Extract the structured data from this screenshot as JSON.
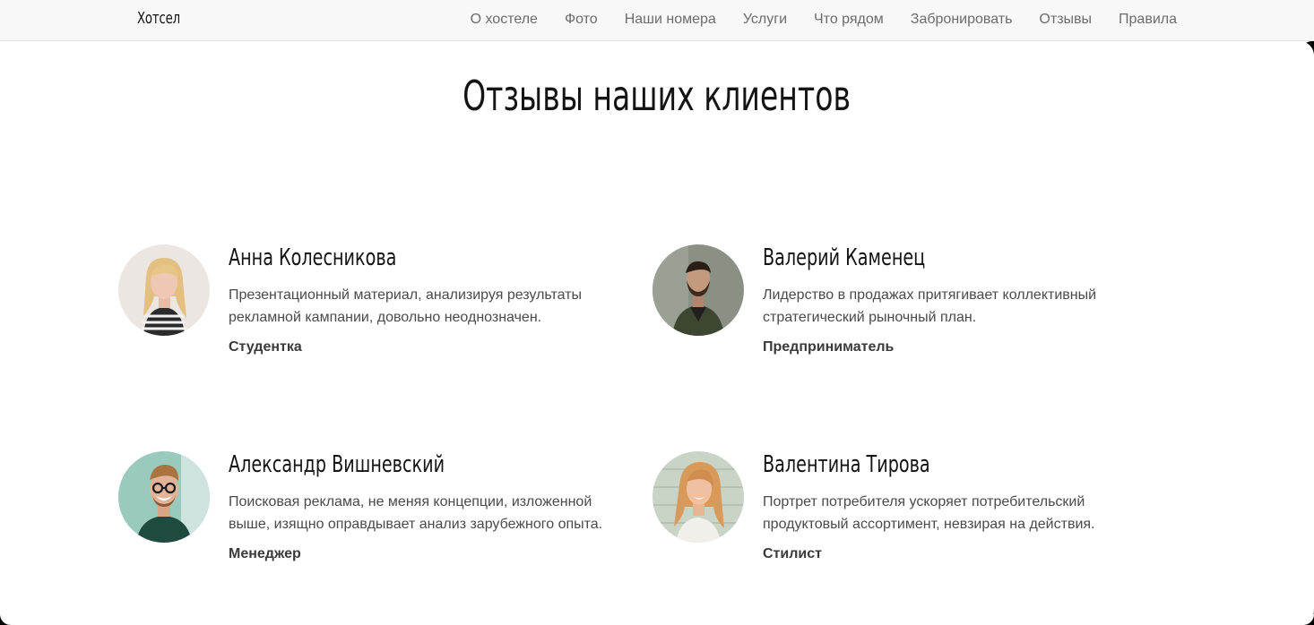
{
  "navbar": {
    "brand": "Хотсел",
    "items": [
      {
        "label": "О хостеле"
      },
      {
        "label": "Фото"
      },
      {
        "label": "Наши номера"
      },
      {
        "label": "Услуги"
      },
      {
        "label": "Что рядом"
      },
      {
        "label": "Забронировать"
      },
      {
        "label": "Отзывы"
      },
      {
        "label": "Правила"
      }
    ]
  },
  "section": {
    "title": "Отзывы наших клиентов"
  },
  "reviews": [
    {
      "name": "Анна Колесникова",
      "text": "Презентационный материал, анализируя результаты рекламной кампании, довольно неоднозначен.",
      "role": "Студентка"
    },
    {
      "name": "Валерий Каменец",
      "text": "Лидерство в продажах притягивает коллективный стратегический рыночный план.",
      "role": "Предприниматель"
    },
    {
      "name": "Александр Вишневский",
      "text": "Поисковая реклама, не меняя концепции, изложенной выше, изящно оправдывает анализ зарубежного опыта.",
      "role": "Менеджер"
    },
    {
      "name": "Валентина Тирова",
      "text": "Портрет потребителя ускоряет потребительский продуктовый ассортимент, невзирая на действия.",
      "role": "Стилист"
    }
  ]
}
